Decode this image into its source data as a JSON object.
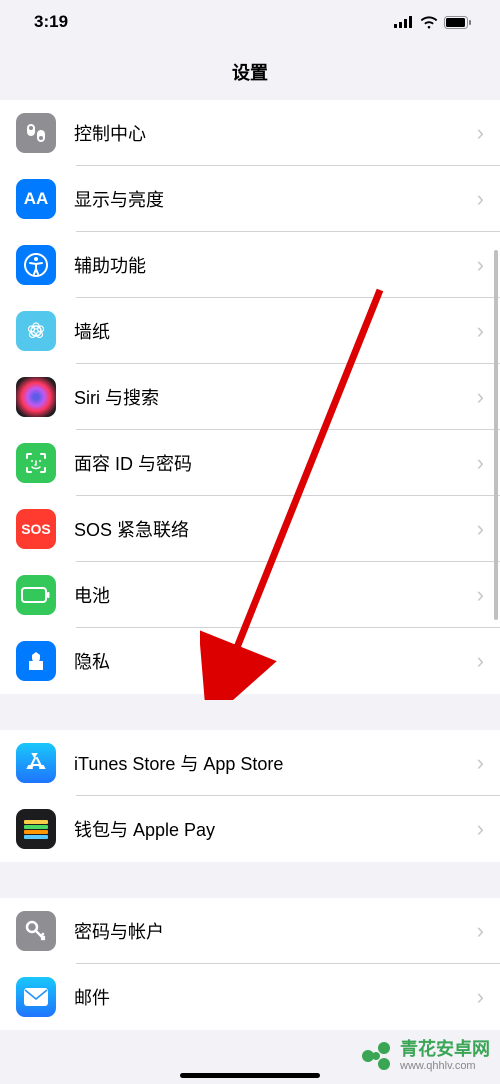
{
  "status": {
    "time": "3:19"
  },
  "nav": {
    "title": "设置"
  },
  "sections": [
    {
      "rows": [
        {
          "id": "control-center",
          "label": "控制中心",
          "bg": "#8e8e93"
        },
        {
          "id": "display",
          "label": "显示与亮度",
          "bg": "#007aff"
        },
        {
          "id": "accessibility",
          "label": "辅助功能",
          "bg": "#007aff"
        },
        {
          "id": "wallpaper",
          "label": "墙纸",
          "bg": "#54c7ec"
        },
        {
          "id": "siri",
          "label": "Siri 与搜索",
          "bg": "#1c1c1e"
        },
        {
          "id": "faceid",
          "label": "面容 ID 与密码",
          "bg": "#34c759"
        },
        {
          "id": "sos",
          "label": "SOS 紧急联络",
          "bg": "#ff3b30"
        },
        {
          "id": "battery",
          "label": "电池",
          "bg": "#34c759"
        },
        {
          "id": "privacy",
          "label": "隐私",
          "bg": "#007aff"
        }
      ]
    },
    {
      "rows": [
        {
          "id": "itunes",
          "label": "iTunes Store 与 App Store",
          "bg": "#1e90ff"
        },
        {
          "id": "wallet",
          "label": "钱包与 Apple Pay",
          "bg": "#1c1c1e"
        }
      ]
    },
    {
      "rows": [
        {
          "id": "passwords",
          "label": "密码与帐户",
          "bg": "#8e8e93"
        },
        {
          "id": "mail",
          "label": "邮件",
          "bg": "#1e90ff"
        }
      ]
    }
  ],
  "watermark": {
    "line1": "青花安卓网",
    "line2": "www.qhhlv.com"
  }
}
